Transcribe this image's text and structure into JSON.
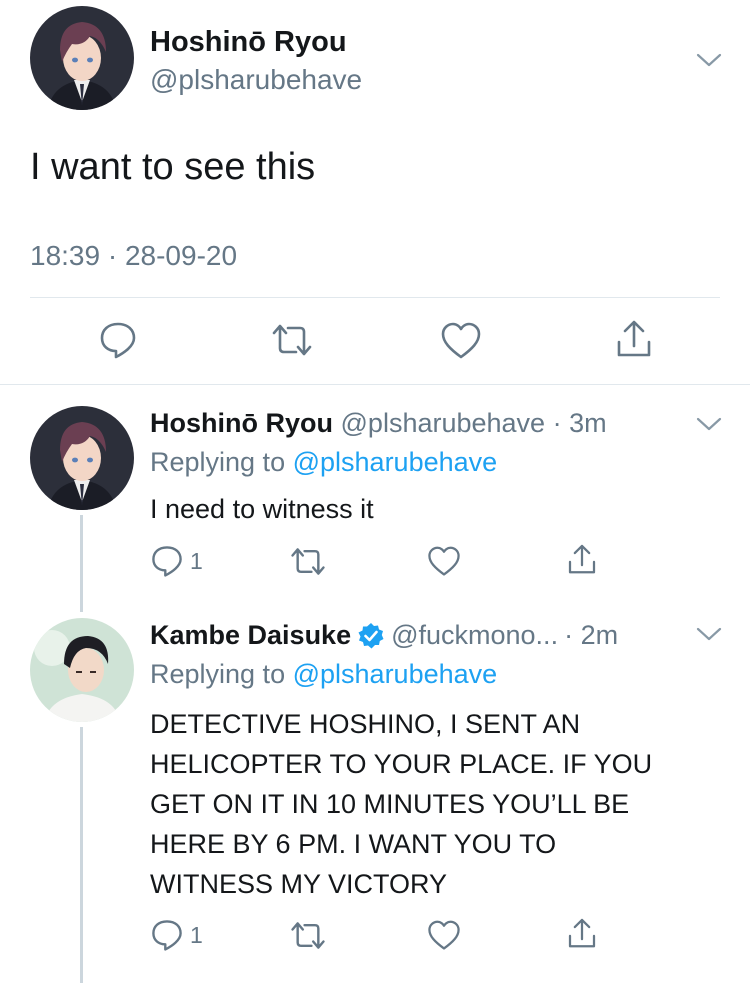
{
  "main_tweet": {
    "author_name": "Hoshinō Ryou",
    "handle": "@plsharubehave",
    "text": "I want to see this",
    "timestamp": "18:39 · 28-09-20",
    "actions": [
      "reply-icon",
      "retweet-icon",
      "like-icon",
      "share-icon"
    ]
  },
  "replies": [
    {
      "author_name": "Hoshinō Ryou",
      "handle": "@plsharubehave",
      "time": "· 3m",
      "replying_prefix": "Replying to",
      "replying_to": "@plsharubehave",
      "text": "I need to witness it",
      "reply_count": "1"
    },
    {
      "author_name": "Kambe Daisuke",
      "verified": true,
      "handle": "@fuckmono...",
      "time": "· 2m",
      "replying_prefix": "Replying to",
      "replying_to": "@plsharubehave",
      "text_lines": [
        "DETECTIVE HOSHINO, I SENT AN",
        "HELICOPTER TO YOUR PLACE. IF YOU",
        "GET ON IT IN 10 MINUTES YOU’LL BE",
        "HERE BY 6 PM. I WANT YOU TO",
        "WITNESS MY VICTORY"
      ],
      "reply_count": "1"
    }
  ],
  "colors": {
    "text": "#14171a",
    "secondary": "#657786",
    "link": "#1da1f2",
    "divider": "#e1e8ed",
    "verified": "#1da1f2"
  }
}
